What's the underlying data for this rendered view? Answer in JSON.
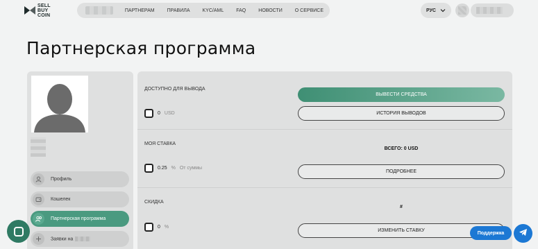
{
  "header": {
    "logo_text": [
      "SELL",
      "BUY",
      "COIN"
    ],
    "nav_items": [
      "ПАРТНЕРАМ",
      "ПРАВИЛА",
      "KYC/AML",
      "FAQ",
      "НОВОСТИ",
      "О СЕРВИСЕ"
    ],
    "language": "РУС"
  },
  "page_title": "Партнерская программа",
  "sidebar": {
    "items": [
      {
        "label": "Профиль",
        "icon": "user-icon",
        "active": false
      },
      {
        "label": "Кошелек",
        "icon": "wallet-icon",
        "active": false
      },
      {
        "label": "Партнерская программа",
        "icon": "users-icon",
        "active": true
      },
      {
        "label": "Заявки на",
        "icon": "plus-icon",
        "active": false
      }
    ]
  },
  "main": {
    "available": {
      "label": "ДОСТУПНО ДЛЯ ВЫВОДА",
      "value": "0",
      "unit": "USD",
      "primary_button": "ВЫВЕСТИ СРЕДСТВА",
      "secondary_button": "ИСТОРИЯ ВЫВОДОВ"
    },
    "rate": {
      "label": "МОЯ СТАВКА",
      "value": "0.25",
      "unit": "%",
      "unit_note": "От суммы",
      "total": "ВСЕГО: 0 USD",
      "button": "ПОДРОБНЕЕ"
    },
    "discount": {
      "label": "СКИДКА",
      "value": "0",
      "unit": "%",
      "hash": "#",
      "button": "ИЗМЕНИТЬ СТАВКУ"
    }
  },
  "support_label": "Поддержка",
  "colors": {
    "accent": "#4a9a80",
    "support_blue": "#1c78d4",
    "panel_bg": "#dfe0e0",
    "page_bg": "#f2f3f3"
  }
}
